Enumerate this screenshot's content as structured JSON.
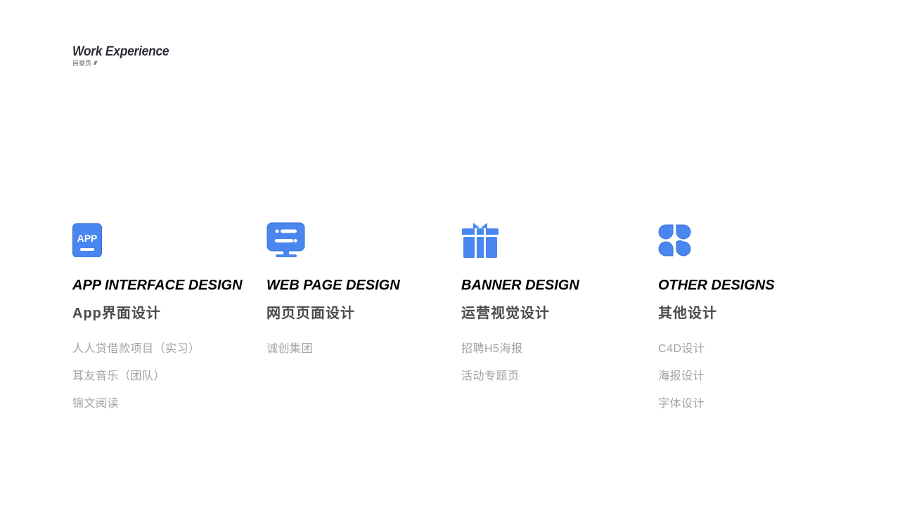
{
  "header": {
    "title": "Work Experience",
    "subtitle": "目录页",
    "slashes": "////////"
  },
  "accent_color": "#4a86f0",
  "columns": [
    {
      "icon": "app-icon",
      "title": "APP INTERFACE DESIGN",
      "subtitle": "App界面设计",
      "items": [
        "人人贷借款项目（实习）",
        "耳友音乐（团队）",
        "锦文阅读"
      ]
    },
    {
      "icon": "monitor-icon",
      "title": "WEB PAGE DESIGN",
      "subtitle": "网页页面设计",
      "items": [
        "诚创集团"
      ]
    },
    {
      "icon": "gift-icon",
      "title": "BANNER DESIGN",
      "subtitle": "运营视觉设计",
      "items": [
        "招聘H5海报",
        "活动专题页"
      ]
    },
    {
      "icon": "grid-icon",
      "title": "OTHER DESIGNS",
      "subtitle": "其他设计",
      "items": [
        "C4D设计",
        "海报设计",
        "字体设计"
      ]
    }
  ]
}
